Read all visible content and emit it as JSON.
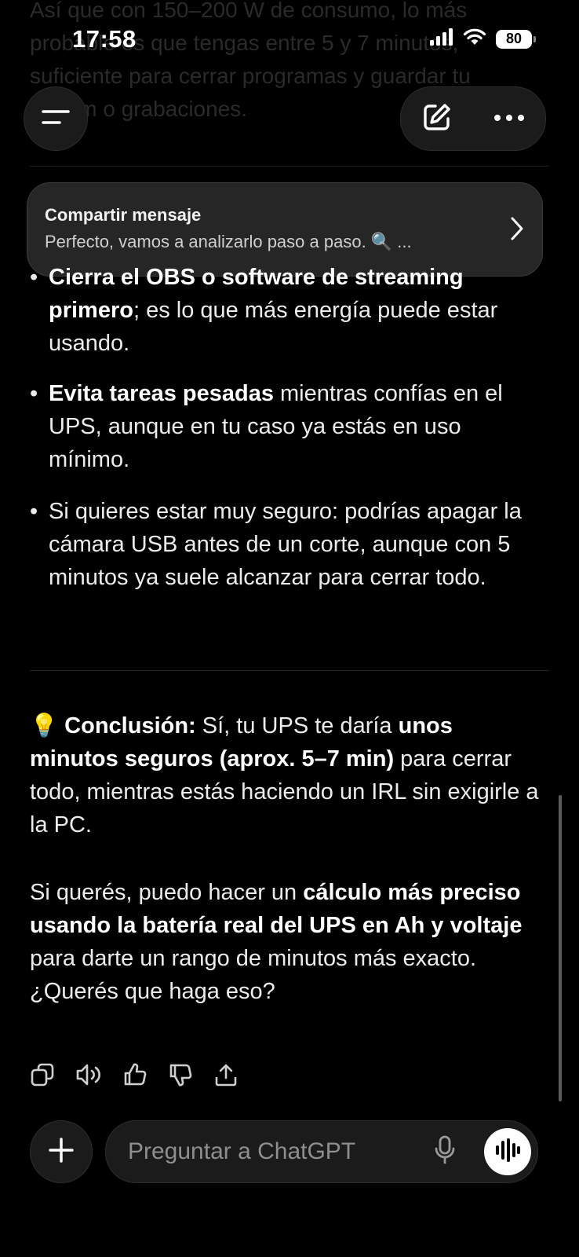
{
  "status_bar": {
    "time": "17:58",
    "battery": "80"
  },
  "faded_text": {
    "line1": "Así que con 150–200 W de consumo, lo más",
    "line2": "probable es que tengas entre 5 y 7 minutos,",
    "line3": "suficiente para cerrar programas y guardar tu",
    "line4": "stream o grabaciones."
  },
  "share_card": {
    "title": "Compartir mensaje",
    "preview": "Perfecto, vamos a analizarlo paso a paso. 🔍 ..."
  },
  "bullets": [
    {
      "bold": "Cierra el OBS o software de streaming primero",
      "rest": "; es lo que más energía puede estar usando."
    },
    {
      "bold": "Evita tareas pesadas",
      "rest": " mientras confías en el UPS, aunque en tu caso ya estás en uso mínimo."
    },
    {
      "bold": "",
      "rest": "Si quieres estar muy seguro: podrías apagar la cámara USB antes de un corte, aunque con 5 minutos ya suele alcanzar para cerrar todo."
    }
  ],
  "conclusion": {
    "emoji": "💡",
    "label": "Conclusión:",
    "text1": " Sí, tu UPS te daría ",
    "bold1": "unos minutos seguros (aprox. 5–7 min)",
    "text2": " para cerrar todo, mientras estás haciendo un IRL sin exigirle a la PC."
  },
  "offer": {
    "text1": "Si querés, puedo hacer un ",
    "bold1": "cálculo más preciso usando la batería real del UPS en Ah y voltaje",
    "text2": " para darte un rango de minutos más exacto.",
    "question": "¿Querés que haga eso?"
  },
  "composer": {
    "placeholder": "Preguntar a ChatGPT"
  },
  "icons": {
    "menu": "menu-icon",
    "edit": "new-chat-icon",
    "more": "more-icon",
    "copy": "copy-icon",
    "speaker": "read-aloud-icon",
    "thumb_up": "thumbs-up-icon",
    "thumb_down": "thumbs-down-icon",
    "share": "share-icon",
    "plus": "plus-icon",
    "mic": "mic-icon",
    "voice": "voice-mode-icon"
  },
  "colors": {
    "background": "#000000",
    "text": "#ececec",
    "surface": "#1b1b1b"
  }
}
